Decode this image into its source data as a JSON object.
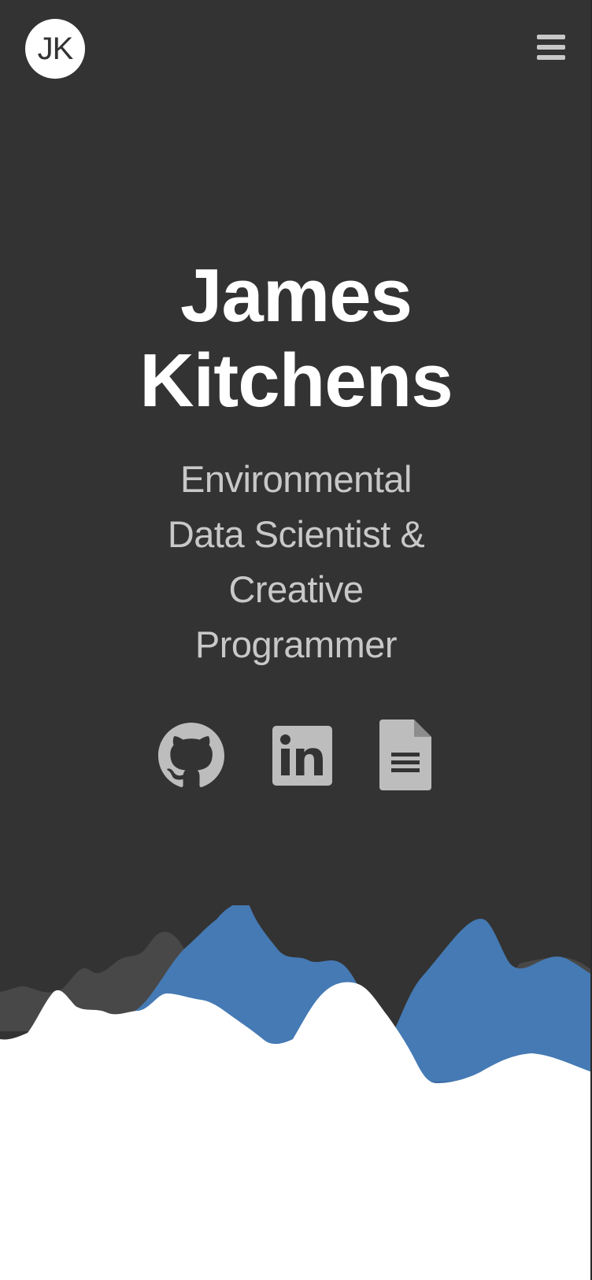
{
  "header": {
    "logo_text": "JK",
    "menu_icon": "hamburger-menu-icon"
  },
  "hero": {
    "name_line1": "James",
    "name_line2": "Kitchens",
    "tagline": "Environmental Data Scientist & Creative Programmer"
  },
  "socials": [
    {
      "name": "GitHub",
      "icon": "github-icon"
    },
    {
      "name": "LinkedIn",
      "icon": "linkedin-icon"
    },
    {
      "name": "CV",
      "icon": "document-icon"
    }
  ],
  "colors": {
    "background": "#333333",
    "text_primary": "#ffffff",
    "text_secondary": "#c8c8c8",
    "icon": "#bdbdbd",
    "ridge_dark": "#484848",
    "ridge_blue": "#457ab4",
    "ridge_blue_shadow": "#3b6aa0",
    "ridge_light": "#ffffff"
  }
}
